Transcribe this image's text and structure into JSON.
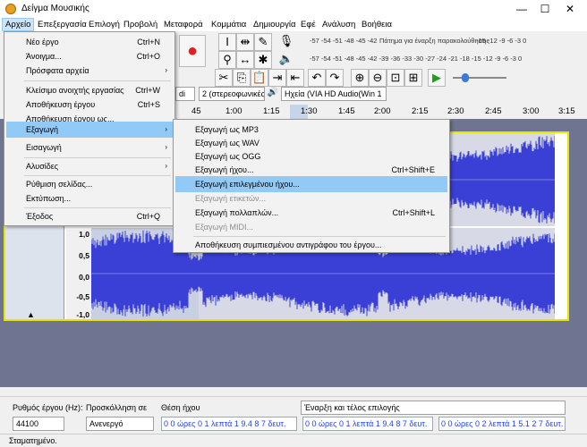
{
  "window": {
    "title": "Δείγμα Μουσικής",
    "minimize": "—",
    "maximize": "☐",
    "close": "✕"
  },
  "menubar": [
    "Αρχείο",
    "Επεξεργασία",
    "Επιλογή",
    "Προβολή",
    "Μεταφορά",
    "Κομμάτια",
    "Δημιουργία",
    "Εφέ",
    "Ανάλυση",
    "Βοήθεια"
  ],
  "meter": {
    "record_scale": "-57 -54 -51 -48 -45 -42",
    "record_hint": "Πάτημα για έναρξη παρακολούθησης",
    "record_scale_right": "-15 -12 -9 -6 -3 0",
    "play_scale": "-57 -54 -51 -48 -45 -42 -39 -36 -33 -30 -27 -24 -21 -18 -15 -12 -9 -6 -3 0"
  },
  "devices": {
    "host": "di",
    "channels": "2 (στερεοφωνικές",
    "output": "Ηχεία (VIA HD Audio(Win 1"
  },
  "ruler": [
    "45",
    "1:00",
    "1:15",
    "1:30",
    "1:45",
    "2:00",
    "2:15",
    "2:30",
    "2:45",
    "3:00",
    "3:15"
  ],
  "vscale": [
    "1,0",
    "0,5",
    "0,0",
    "-0,5",
    "-1,0"
  ],
  "file_menu": {
    "items": [
      {
        "label": "Νέο έργο",
        "shortcut": "Ctrl+N"
      },
      {
        "label": "Άνοιγμα...",
        "shortcut": "Ctrl+O"
      },
      {
        "label": "Πρόσφατα αρχεία",
        "shortcut": ""
      },
      {
        "label": "Κλείσιμο ανοιχτής εργασίας",
        "shortcut": "Ctrl+W"
      },
      {
        "label": "Αποθήκευση έργου",
        "shortcut": "Ctrl+S"
      },
      {
        "label": "Αποθήκευση έργου ως...",
        "shortcut": ""
      },
      {
        "label": "Εξαγωγή",
        "shortcut": ""
      },
      {
        "label": "Εισαγωγή",
        "shortcut": ""
      },
      {
        "label": "Αλυσίδες",
        "shortcut": ""
      },
      {
        "label": "Ρύθμιση σελίδας...",
        "shortcut": ""
      },
      {
        "label": "Εκτύπωση...",
        "shortcut": ""
      },
      {
        "label": "Έξοδος",
        "shortcut": "Ctrl+Q"
      }
    ]
  },
  "export_menu": {
    "items": [
      {
        "label": "Εξαγωγή ως MP3",
        "shortcut": ""
      },
      {
        "label": "Εξαγωγή ως WAV",
        "shortcut": ""
      },
      {
        "label": "Εξαγωγή ως OGG",
        "shortcut": ""
      },
      {
        "label": "Εξαγωγή ήχου...",
        "shortcut": "Ctrl+Shift+E"
      },
      {
        "label": "Εξαγωγή επιλεγμένου ήχου...",
        "shortcut": ""
      },
      {
        "label": "Εξαγωγή ετικετών...",
        "shortcut": ""
      },
      {
        "label": "Εξαγωγή πολλαπλών...",
        "shortcut": "Ctrl+Shift+L"
      },
      {
        "label": "Εξαγωγή MIDI...",
        "shortcut": ""
      },
      {
        "label": "Αποθήκευση συμπιεσμένου αντιγράφου του έργου...",
        "shortcut": ""
      }
    ]
  },
  "bottom": {
    "rate_label": "Ρυθμός έργου (Hz):",
    "rate_value": "44100",
    "snap_label": "Προσκόλληση σε",
    "snap_value": "Ανενεργό",
    "pos_label": "Θέση ήχου",
    "pos_value": "0 0 ώρες 0 1 λεπτά 1 9.4 8 7 δευτ.",
    "sel_label": "Έναρξη και τέλος επιλογής",
    "sel_start": "0 0 ώρες 0 1 λεπτά 1 9.4 8 7 δευτ.",
    "sel_end": "0 0 ώρες 0 2 λεπτά 1 5.1 2 7 δευτ."
  },
  "status": "Σταματημένο.",
  "colors": {
    "wave": "#3a3fd6",
    "selection": "#91c9f7",
    "track_border": "#e6e600"
  }
}
